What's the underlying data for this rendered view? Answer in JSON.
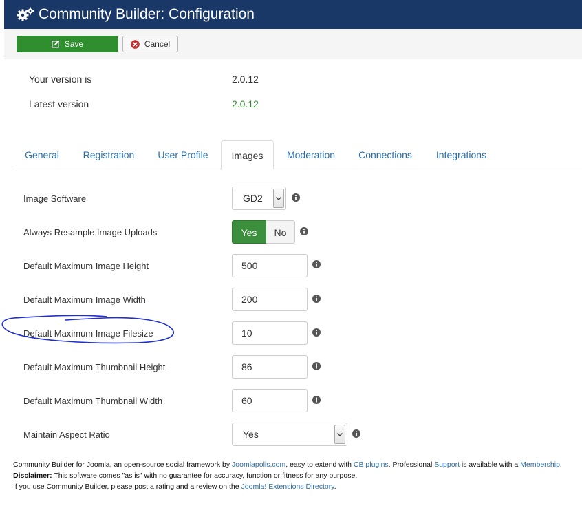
{
  "header": {
    "title": "Community Builder: Configuration",
    "icon": "gears-icon"
  },
  "toolbar": {
    "save_label": "Save",
    "cancel_label": "Cancel"
  },
  "version": {
    "your_label": "Your version is",
    "your_value": "2.0.12",
    "latest_label": "Latest version",
    "latest_value": "2.0.12"
  },
  "tabs": [
    {
      "label": "General"
    },
    {
      "label": "Registration"
    },
    {
      "label": "User Profile"
    },
    {
      "label": "Images"
    },
    {
      "label": "Moderation"
    },
    {
      "label": "Connections"
    },
    {
      "label": "Integrations"
    }
  ],
  "active_tab": "Images",
  "fields": {
    "image_software": {
      "label": "Image Software",
      "value": "GD2"
    },
    "always_resample": {
      "label": "Always Resample Image Uploads",
      "yes": "Yes",
      "no": "No",
      "selected": "Yes"
    },
    "max_height": {
      "label": "Default Maximum Image Height",
      "value": "500"
    },
    "max_width": {
      "label": "Default Maximum Image Width",
      "value": "200"
    },
    "max_filesize": {
      "label": "Default Maximum Image Filesize",
      "value": "10"
    },
    "thumb_height": {
      "label": "Default Maximum Thumbnail Height",
      "value": "86"
    },
    "thumb_width": {
      "label": "Default Maximum Thumbnail Width",
      "value": "60"
    },
    "aspect_ratio": {
      "label": "Maintain Aspect Ratio",
      "value": "Yes"
    }
  },
  "footer": {
    "l1_a": "Community Builder for Joomla, an open-source social framework by ",
    "l1_link1": "Joomlapolis.com",
    "l1_b": ", easy to extend with ",
    "l1_link2": "CB plugins",
    "l1_c": ". Professional ",
    "l1_link3": "Support",
    "l1_d": " is available with a ",
    "l1_link4": "Membership",
    "l1_e": ".",
    "l2_bold": "Disclaimer:",
    "l2_text": " This software comes \"as is\" with no guarantee for accuracy, function or fitness for any purpose.",
    "l3_a": "If you use Community Builder, please post a rating and a review on the ",
    "l3_link": "Joomla! Extensions Directory",
    "l3_b": "."
  },
  "colors": {
    "header_bg": "#1a3867",
    "save_bg": "#2f8f2f",
    "link": "#2a6fad",
    "version_green": "#3a8a3a",
    "annotation": "#1f2fd0"
  }
}
